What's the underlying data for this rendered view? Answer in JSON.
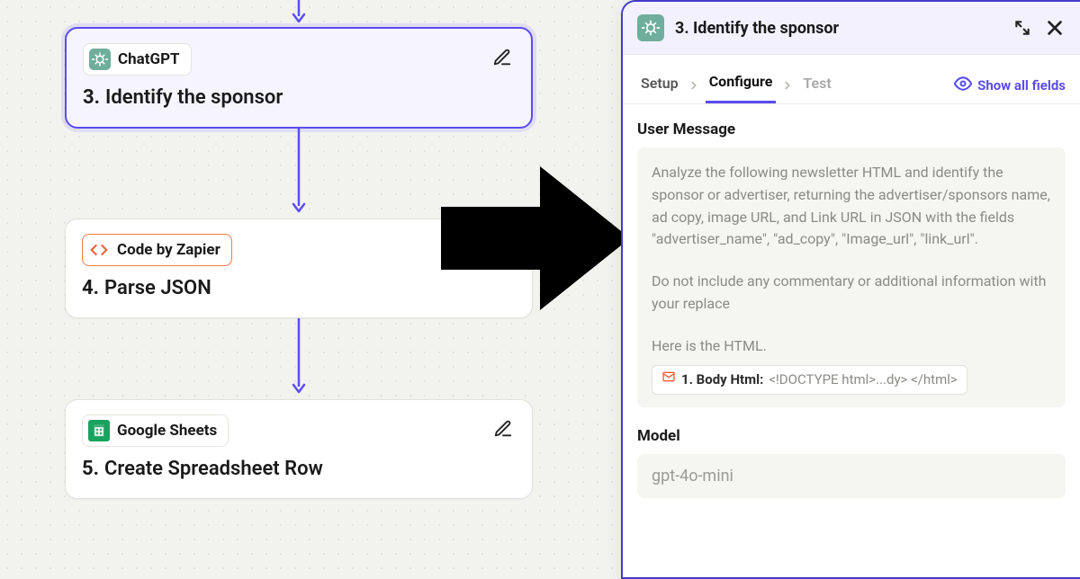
{
  "flow": {
    "step3": {
      "app": "ChatGPT",
      "num": "3.",
      "title": "Identify the sponsor"
    },
    "step4": {
      "app": "Code by Zapier",
      "num": "4.",
      "title": "Parse JSON"
    },
    "step5": {
      "app": "Google Sheets",
      "num": "5.",
      "title": "Create Spreadsheet Row"
    }
  },
  "panel": {
    "header": {
      "num": "3.",
      "title": "Identify the sponsor"
    },
    "tabs": {
      "setup": "Setup",
      "configure": "Configure",
      "test": "Test",
      "show_all": "Show all fields"
    },
    "user_message": {
      "label": "User Message",
      "p1": "Analyze the following newsletter HTML and identify the sponsor or advertiser, returning the advertiser/sponsors name, ad copy, image URL, and Link URL in JSON with the fields \"advertiser_name\", \"ad_copy\", \"Image_url\", \"link_url\".",
      "p2": "Do not include any commentary or additional information with your replace",
      "p3": "Here is the HTML.",
      "pill_key": "1. Body Html:",
      "pill_val": "<!DOCTYPE html>...dy> </html>"
    },
    "model": {
      "label": "Model",
      "value": "gpt-4o-mini"
    }
  }
}
